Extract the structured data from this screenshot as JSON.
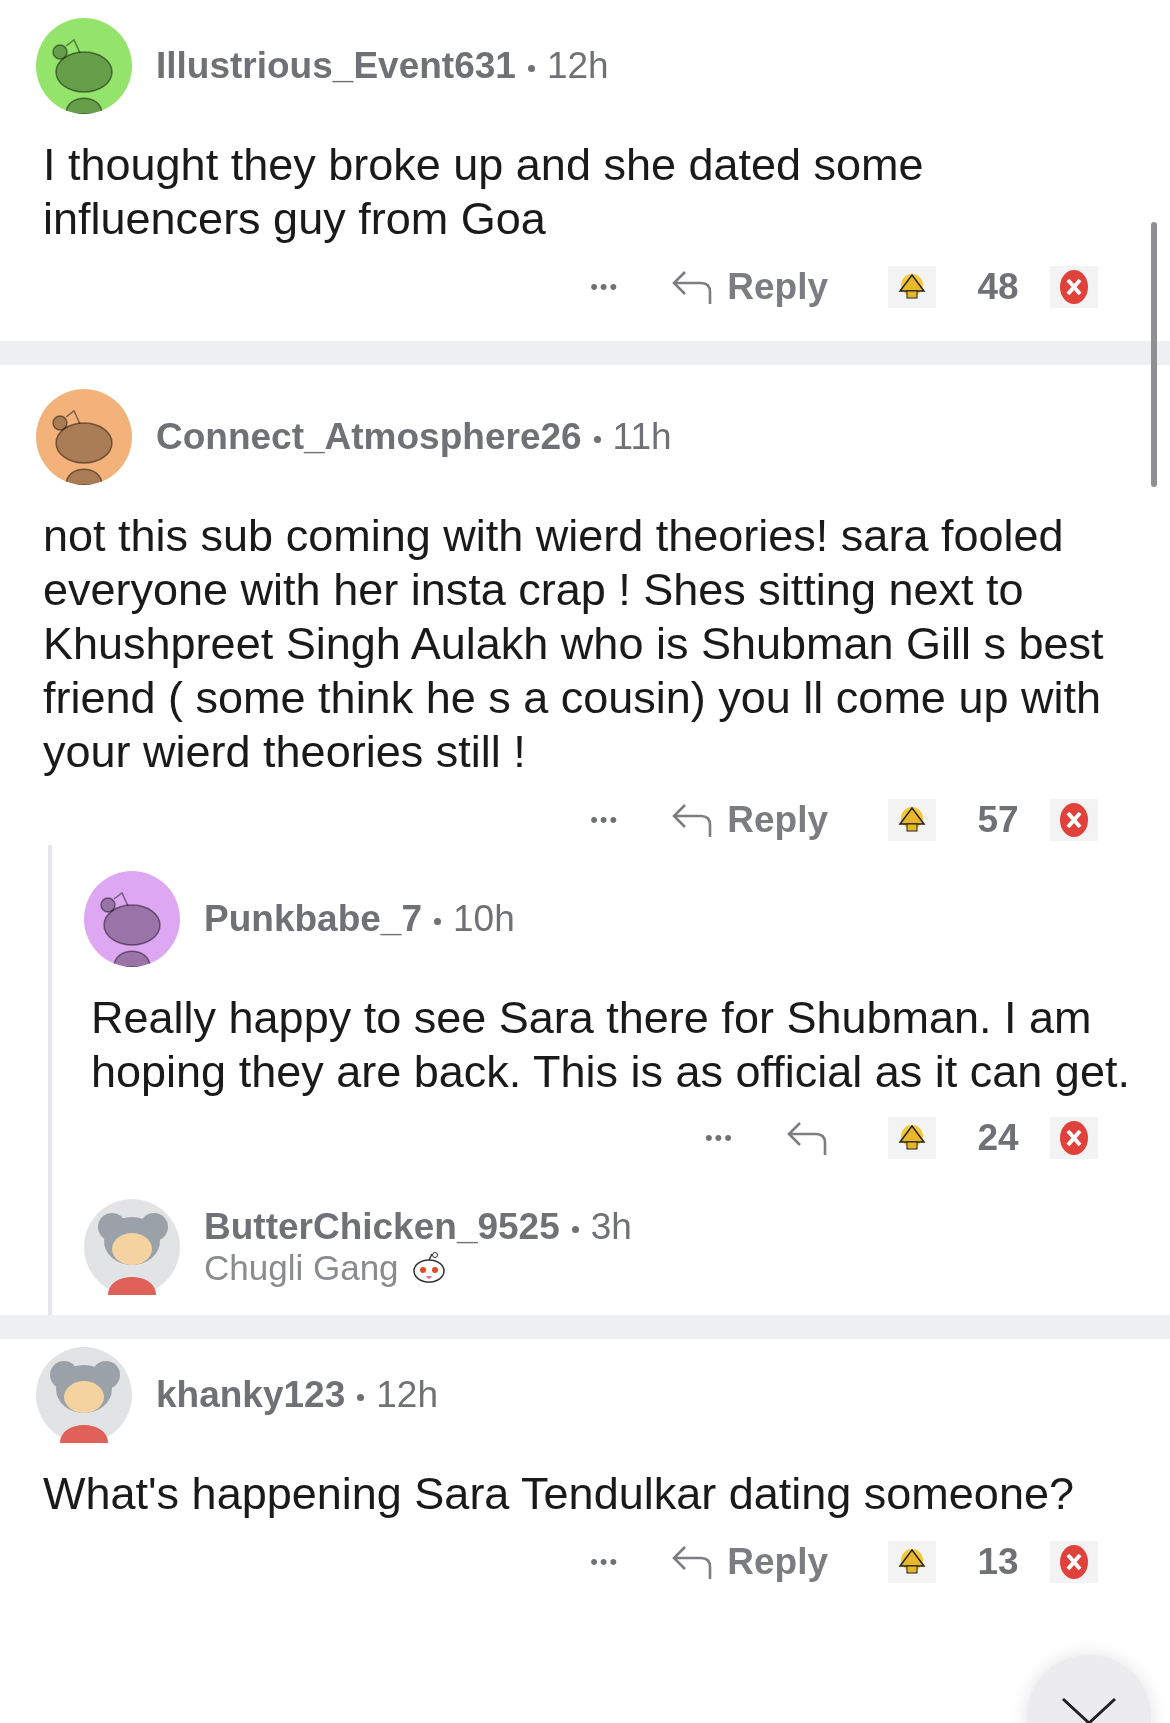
{
  "comments": [
    {
      "avatar": {
        "kind": "snoo",
        "color": "#94e36b"
      },
      "username": "Illustrious_Event631",
      "time": "12h",
      "body": "I thought they broke up and she dated some influencers guy from Goa",
      "actions": {
        "more": "•••",
        "reply_label": "Reply",
        "score": "48"
      }
    },
    {
      "avatar": {
        "kind": "snoo",
        "color": "#f2b27a"
      },
      "username": "Connect_Atmosphere26",
      "time": "11h",
      "body": "not this sub coming with wierd theories! sara fooled everyone with her insta crap ! Shes sitting next to Khushpreet Singh Aulakh who is Shubman Gill s best friend ( some think he s a cousin) you ll come up with your wierd theories still !",
      "actions": {
        "more": "•••",
        "reply_label": "Reply",
        "score": "57"
      },
      "replies": [
        {
          "avatar": {
            "kind": "snoo",
            "color": "#dda7f2"
          },
          "username": "Punkbabe_7",
          "time": "10h",
          "body": "Really happy to see Sara there for Shubman. I am hoping they are back. This is as official as it can get.",
          "actions": {
            "more": "•••",
            "score": "24"
          }
        },
        {
          "username": "ButterChicken_9525",
          "time": "3h",
          "flair": "Chugli Gang"
        }
      ]
    },
    {
      "username": "khanky123",
      "time": "12h",
      "body": "What's happening Sara Tendulkar dating someone?",
      "actions": {
        "more": "•••",
        "reply_label": "Reply",
        "score": "13"
      }
    }
  ]
}
